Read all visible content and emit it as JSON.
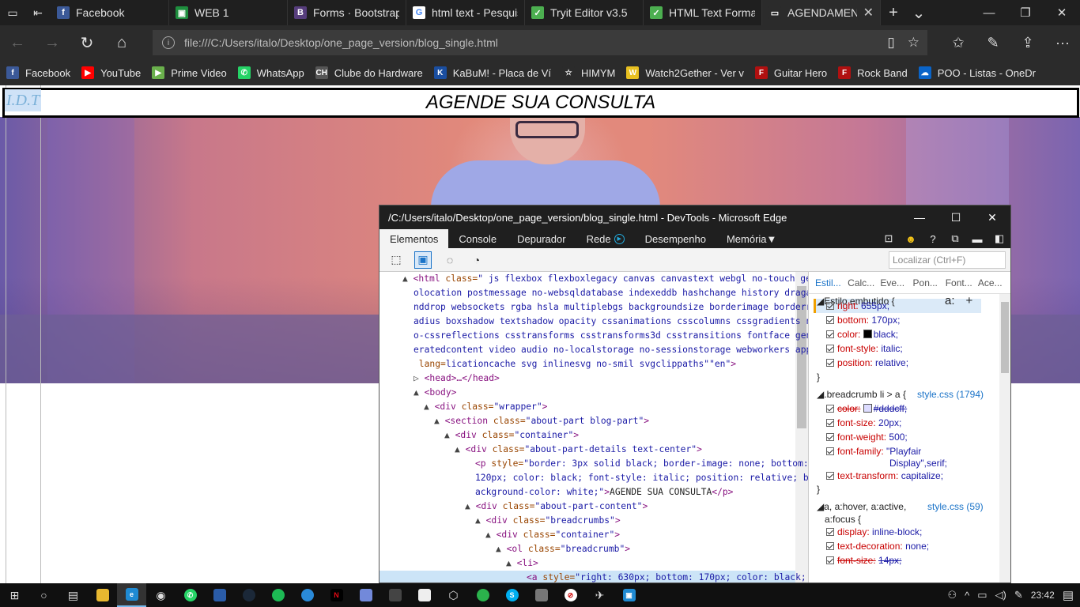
{
  "browser": {
    "tabs": [
      {
        "title": "Facebook",
        "icon": "facebook-icon",
        "color": "#3b5998",
        "glyph": "f"
      },
      {
        "title": "WEB 1",
        "icon": "classroom-icon",
        "color": "#1e8e3e",
        "glyph": "▣"
      },
      {
        "title": "Forms · Bootstrap",
        "icon": "bootstrap-icon",
        "color": "#563d7c",
        "glyph": "B"
      },
      {
        "title": "html text - Pesquis",
        "icon": "google-icon",
        "color": "#ffffff",
        "glyph": "G"
      },
      {
        "title": "Tryit Editor v3.5",
        "icon": "w3schools-icon",
        "color": "#4caf50",
        "glyph": "✓"
      },
      {
        "title": "HTML Text Formatt",
        "icon": "w3schools-icon",
        "color": "#4caf50",
        "glyph": "✓"
      },
      {
        "title": "AGENDAMENT",
        "icon": "page-icon",
        "color": "#2b2b2b",
        "glyph": "▭"
      }
    ],
    "address": "file:///C:/Users/italo/Desktop/one_page_version/blog_single.html",
    "favorites": [
      {
        "label": "Facebook",
        "icon": "facebook-icon",
        "color": "#3b5998",
        "glyph": "f"
      },
      {
        "label": "YouTube",
        "icon": "youtube-icon",
        "color": "#ff0000",
        "glyph": "▶"
      },
      {
        "label": "Prime Video",
        "icon": "prime-video-icon",
        "color": "#6ab04c",
        "glyph": "▶"
      },
      {
        "label": "WhatsApp",
        "icon": "whatsapp-icon",
        "color": "#25d366",
        "glyph": "✆"
      },
      {
        "label": "Clube do Hardware",
        "icon": "clube-hardware-icon",
        "color": "#555555",
        "glyph": "CH"
      },
      {
        "label": "KaBuM! - Placa de Ví",
        "icon": "kabum-icon",
        "color": "#1a4ea0",
        "glyph": "K"
      },
      {
        "label": "HIMYM",
        "icon": "star-icon",
        "color": "#2b2b2b",
        "glyph": "☆"
      },
      {
        "label": "Watch2Gether - Ver v",
        "icon": "watch2gether-icon",
        "color": "#e8c020",
        "glyph": "W"
      },
      {
        "label": "Guitar Hero",
        "icon": "guitar-hero-icon",
        "color": "#b01010",
        "glyph": "F"
      },
      {
        "label": "Rock Band",
        "icon": "rock-band-icon",
        "color": "#b01010",
        "glyph": "F"
      },
      {
        "label": "POO - Listas - OneDr",
        "icon": "onedrive-icon",
        "color": "#0a64c8",
        "glyph": "☁"
      }
    ]
  },
  "page": {
    "logo": "I.D.T",
    "title": "AGENDE SUA CONSULTA"
  },
  "devtools": {
    "window_title": "/C:/Users/italo/Desktop/one_page_version/blog_single.html - DevTools - Microsoft Edge",
    "tabs": [
      "Elementos",
      "Console",
      "Depurador",
      "Rede",
      "Desempenho",
      "Memória"
    ],
    "find_placeholder": "Localizar (Ctrl+F)",
    "dom_lines": [
      {
        "t": "▲ ",
        "tag": "<html ",
        "attr": "class=",
        "val": "\" js flexbox flexboxlegacy canvas canvastext webgl no-touch ge"
      },
      {
        "val": "olocation postmessage no-websqldatabase indexeddb hashchange history draga"
      },
      {
        "val": "nddrop websockets rgba hsla multiplebgs backgroundsize borderimage borderr"
      },
      {
        "val": "adius boxshadow textshadow opacity cssanimations csscolumns cssgradients n"
      },
      {
        "val": "o-cssreflections csstransforms csstransforms3d csstransitions fontface gen"
      },
      {
        "val": "eratedcontent video audio no-localstorage no-sessionstorage webworkers app"
      },
      {
        "val": "licationcache svg inlinesvg no-smil svgclippaths\"",
        "attr": " lang=",
        "val2": "\"en\"",
        "tag2": ">"
      },
      {
        "t": "▷ ",
        "tag": "<head>…</head>"
      },
      {
        "t": "▲ ",
        "tag": "<body>"
      },
      {
        "t": "▲ ",
        "tag": "<div ",
        "attr": "class=",
        "val": "\"wrapper\"",
        "tag2": ">"
      },
      {
        "t": "▲ ",
        "tag": "<section ",
        "attr": "class=",
        "val": "\"about-part blog-part\"",
        "tag2": ">"
      },
      {
        "t": "▲ ",
        "tag": "<div ",
        "attr": "class=",
        "val": "\"container\"",
        "tag2": ">"
      },
      {
        "t": "▲ ",
        "tag": "<div ",
        "attr": "class=",
        "val": "\"about-part-details text-center\"",
        "tag2": ">"
      },
      {
        "tag": "<p ",
        "attr": "style=",
        "val": "\"border: 3px solid black; border-image: none; bottom:"
      },
      {
        "val": "120px; color: black; font-style: italic; position: relative; b"
      },
      {
        "val": "ackground-color: white;\"",
        "tag2": ">",
        "text": "AGENDE SUA CONSULTA",
        "tag3": "</p>"
      },
      {
        "t": "▲ ",
        "tag": "<div ",
        "attr": "class=",
        "val": "\"about-part-content\"",
        "tag2": ">"
      },
      {
        "t": "▲ ",
        "tag": "<div ",
        "attr": "class=",
        "val": "\"breadcrumbs\"",
        "tag2": ">"
      },
      {
        "t": "▲ ",
        "tag": "<div ",
        "attr": "class=",
        "val": "\"container\"",
        "tag2": ">"
      },
      {
        "t": "▲ ",
        "tag": "<ol ",
        "attr": "class=",
        "val": "\"breadcrumb\"",
        "tag2": ">"
      },
      {
        "t": "▲ ",
        "tag": "<li>"
      },
      {
        "tag": "<a ",
        "attr": "style=",
        "val": "\"right: 630px; bottom: 170px; color: black; f"
      }
    ],
    "styles": {
      "tabs": [
        "Estil...",
        "Calc...",
        "Eve...",
        "Pon...",
        "Font...",
        "Ace..."
      ],
      "inline_header": "Estilo embutido  {",
      "tools": [
        "a:",
        "+"
      ],
      "inline": [
        {
          "prop": "right:",
          "val": "655px;"
        },
        {
          "prop": "bottom:",
          "val": "170px;"
        },
        {
          "prop": "color:",
          "val": "black;",
          "swatch": "#000000"
        },
        {
          "prop": "font-style:",
          "val": "italic;"
        },
        {
          "prop": "position:",
          "val": "relative;"
        }
      ],
      "rule2_selector": ".breadcrumb li > a  {",
      "rule2_src": "style.css (1794)",
      "rule2": [
        {
          "prop": "color:",
          "val": "#dddcff;",
          "swatch": "#dddcff",
          "strike": true
        },
        {
          "prop": "font-size:",
          "val": "20px;"
        },
        {
          "prop": "font-weight:",
          "val": "500;"
        },
        {
          "prop": "font-family:",
          "val": "\"Playfair",
          "val_b": "Display\",serif;"
        },
        {
          "prop": "text-transform:",
          "val": "capitalize;"
        }
      ],
      "rule3_selector": "a, a:hover, a:active,",
      "rule3_selector_b": "a:focus  {",
      "rule3_src": "style.css (59)",
      "rule3": [
        {
          "prop": "display:",
          "val": "inline-block;"
        },
        {
          "prop": "text-decoration:",
          "val": "none;"
        },
        {
          "prop": "font-size:",
          "val": "14px;",
          "strike": true
        }
      ],
      "close_brace": "}"
    }
  },
  "taskbar": {
    "time": "23:42"
  }
}
